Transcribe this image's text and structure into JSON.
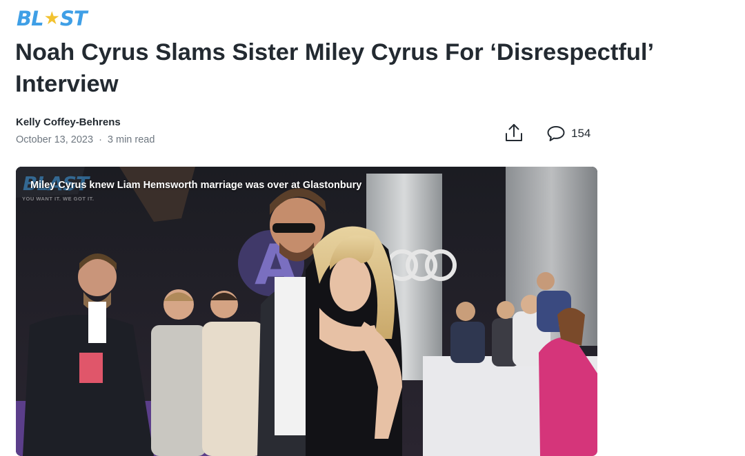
{
  "site": {
    "logo_text_left": "BL",
    "logo_star": "★",
    "logo_text_right": "ST",
    "logo_color": "#3f9fe6",
    "star_color": "#f2c230"
  },
  "article": {
    "headline": "Noah Cyrus Slams Sister Miley Cyrus For ‘Disrespectful’ Interview",
    "author": "Kelly Coffey-Behrens",
    "date": "October 13, 2023",
    "separator": "·",
    "read_time": "3 min read"
  },
  "actions": {
    "share_icon": "share-icon",
    "comment_icon": "comment-icon",
    "comment_count": "154"
  },
  "video": {
    "title": "Miley Cyrus knew Liam Hemsworth marriage was over at Glastonbury",
    "watermark_logo": "BLAST",
    "watermark_tagline": "YOU WANT IT.  WE GOT IT."
  }
}
